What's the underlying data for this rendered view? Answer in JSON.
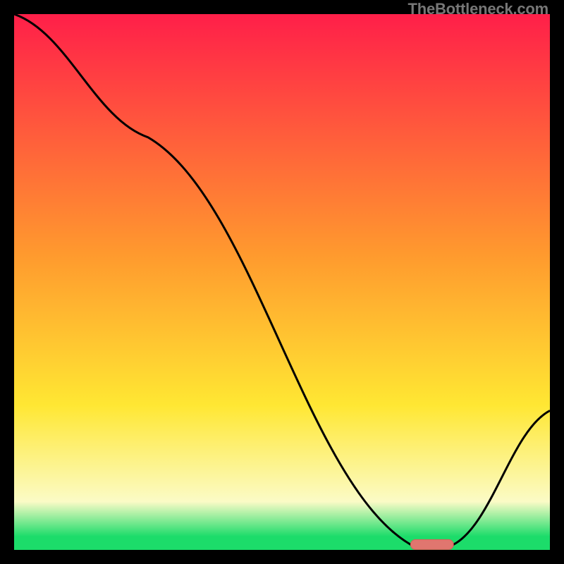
{
  "watermark": "TheBottleneck.com",
  "colors": {
    "red_top": "#ff1f49",
    "orange": "#ff9a2e",
    "yellow": "#ffe733",
    "pale_yellow": "#fbfbc6",
    "green": "#1cdc6a",
    "curve": "#000000",
    "marker_fill": "#e0766f",
    "marker_stroke": "#d86058"
  },
  "chart_data": {
    "type": "line",
    "title": "",
    "xlabel": "",
    "ylabel": "",
    "xlim": [
      0,
      100
    ],
    "ylim": [
      0,
      100
    ],
    "x": [
      0,
      25,
      74,
      82,
      100
    ],
    "y": [
      100,
      77,
      1,
      1,
      26
    ],
    "marker": {
      "x_start": 74,
      "x_end": 82,
      "y": 1
    },
    "gradient_stops": [
      {
        "offset": 0.0,
        "color_key": "red_top"
      },
      {
        "offset": 0.45,
        "color_key": "orange"
      },
      {
        "offset": 0.73,
        "color_key": "yellow"
      },
      {
        "offset": 0.91,
        "color_key": "pale_yellow"
      },
      {
        "offset": 0.975,
        "color_key": "green"
      },
      {
        "offset": 1.0,
        "color_key": "green"
      }
    ]
  }
}
